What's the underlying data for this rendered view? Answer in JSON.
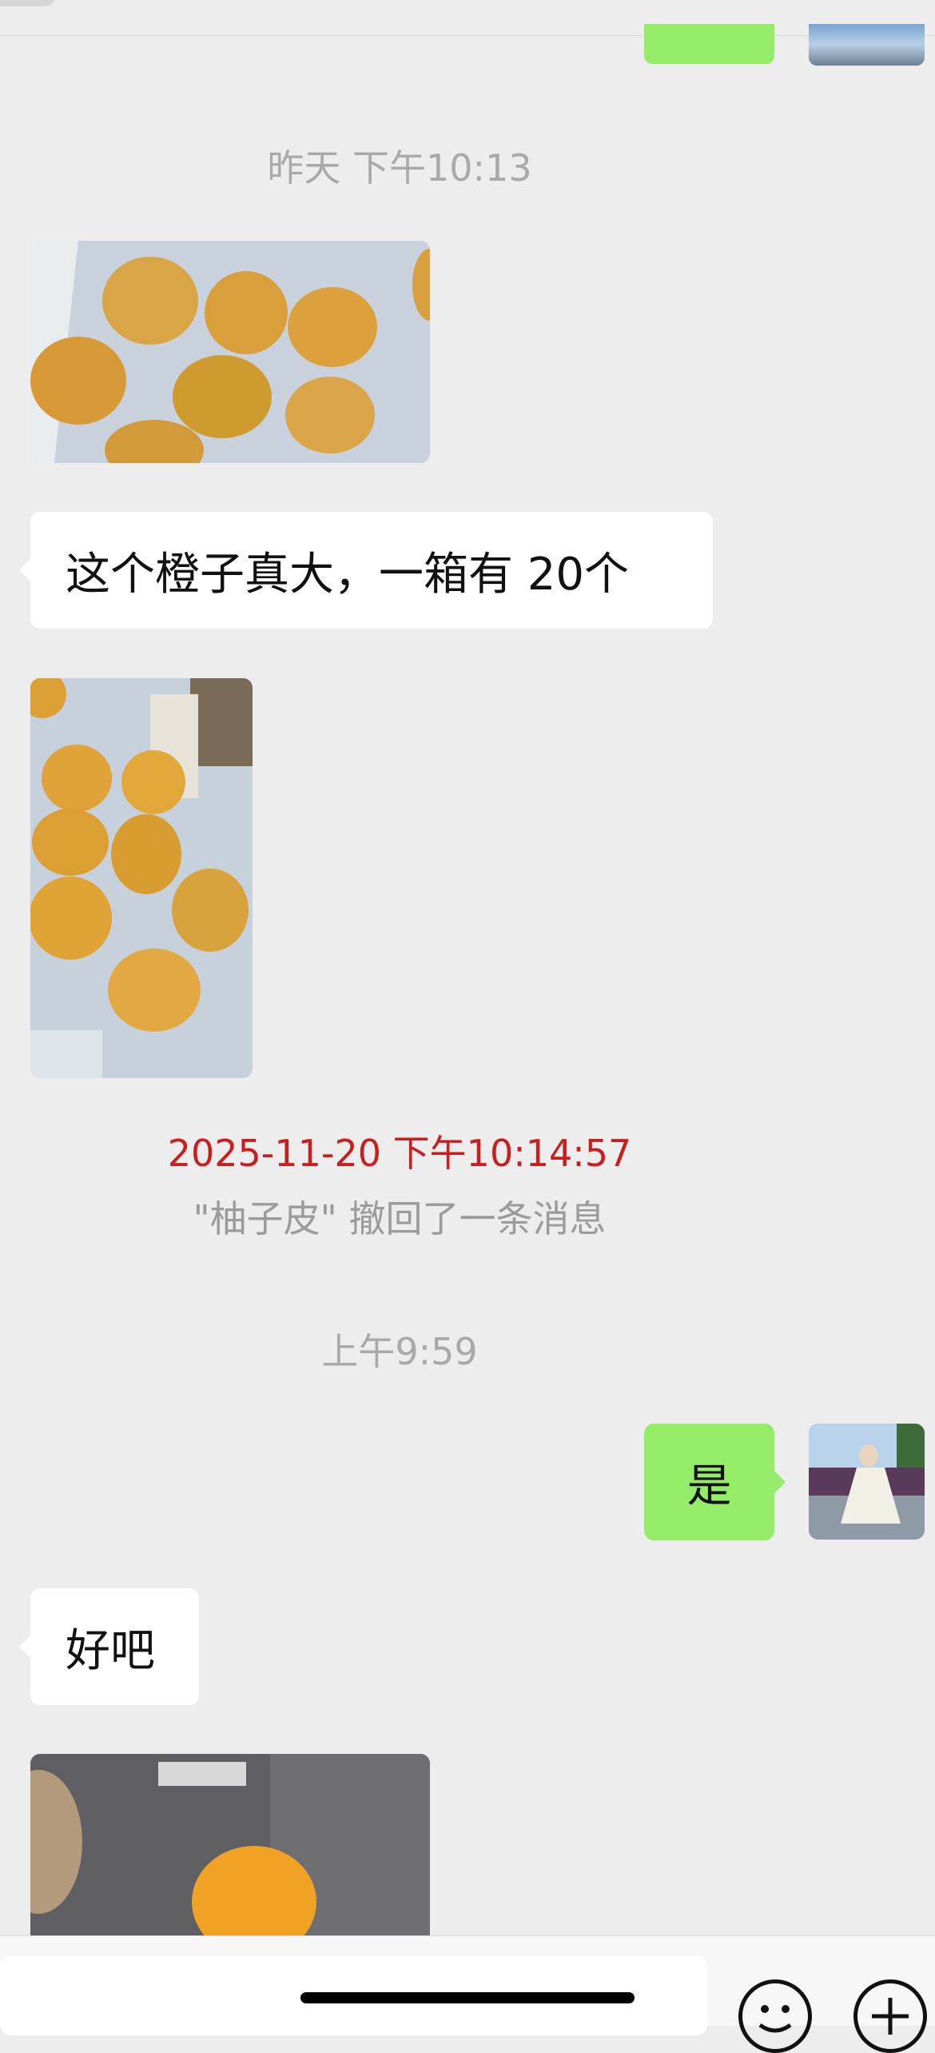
{
  "chat": {
    "timestamp_yesterday": "昨天 下午10:13",
    "msg_oranges_big": "这个橙子真大，一箱有 20个",
    "recall_time": "2025-11-20 下午10:14:57",
    "recall_notice": "\"柚子皮\" 撤回了一条消息",
    "timestamp_morning": "上午9:59",
    "msg_yes": "是",
    "msg_okay": "好吧"
  },
  "icons": {
    "emoji": "emoji-face-icon",
    "plus": "plus-circle-icon"
  },
  "colors": {
    "background": "#ededed",
    "sent_bubble": "#95ec69",
    "received_bubble": "#ffffff",
    "recall_time": "#c81e1e"
  }
}
